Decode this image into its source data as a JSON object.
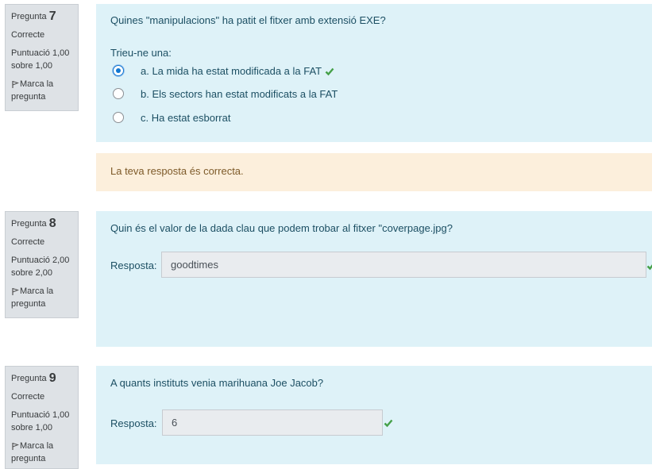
{
  "colors": {
    "info_bg": "#dee2e6",
    "formulation_bg": "#def2f8",
    "feedback_bg": "#fcefdc",
    "correct_green": "#45a048",
    "radio_blue": "#1177d1"
  },
  "questions": [
    {
      "label": "Pregunta",
      "number": "7",
      "state": "Correcte",
      "grade": "Puntuació 1,00 sobre 1,00",
      "flag": "Marca la pregunta",
      "text": "Quines \"manipulacions\" ha patit el fitxer amb extensió EXE?",
      "prompt": "Trieu-ne una:",
      "options": [
        {
          "label": "a. La mida ha estat modificada a la FAT",
          "selected": true,
          "correct": true
        },
        {
          "label": "b. Els sectors han estat modificats a la FAT",
          "selected": false,
          "correct": false
        },
        {
          "label": "c. Ha estat esborrat",
          "selected": false,
          "correct": false
        }
      ],
      "feedback": "La teva resposta és correcta."
    },
    {
      "label": "Pregunta",
      "number": "8",
      "state": "Correcte",
      "grade": "Puntuació 2,00 sobre 2,00",
      "flag": "Marca la pregunta",
      "text": "Quin és el valor de la dada clau que podem trobar al fitxer \"coverpage.jpg?",
      "answer_label": "Resposta:",
      "answer": "goodtimes"
    },
    {
      "label": "Pregunta",
      "number": "9",
      "state": "Correcte",
      "grade": "Puntuació 1,00 sobre 1,00",
      "flag": "Marca la pregunta",
      "text": "A quants instituts venia marihuana Joe Jacob?",
      "answer_label": "Resposta:",
      "answer": "6"
    }
  ]
}
